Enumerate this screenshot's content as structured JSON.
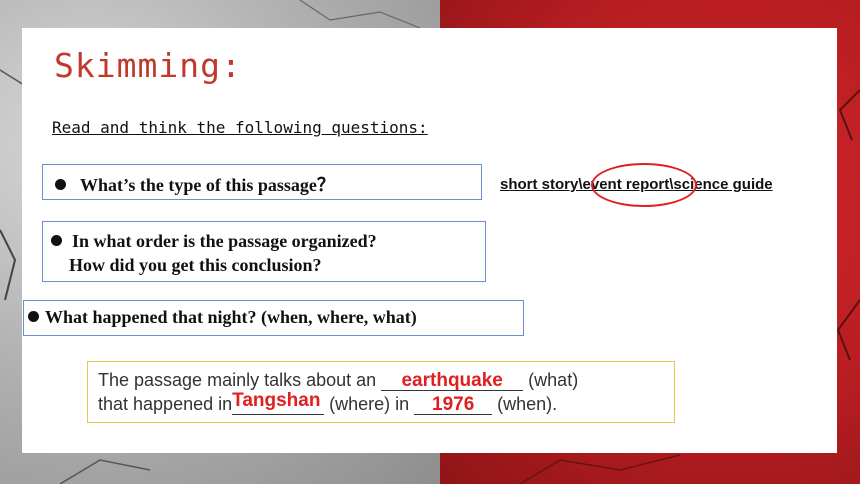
{
  "slide": {
    "title": "Skimming:",
    "instruction": "Read and think the following questions:",
    "questions": [
      {
        "text": "What’s the type of this passage？"
      },
      {
        "line1": "In what order is the passage organized?",
        "line2": "How did you get this conclusion?"
      },
      {
        "text": "What happened that night? (when, where, what)"
      }
    ],
    "choices": {
      "opt1": "short story",
      "sep1": "\\",
      "opt2": "event report",
      "sep2": "\\",
      "opt3": "science guide",
      "circled": "event report"
    },
    "summary": {
      "part1": "The passage mainly talks about an ",
      "answer_what": "earthquake",
      "part2": "  (what)",
      "part3": "that happened in",
      "answer_where": "Tangshan",
      "part4": " (where)  in ",
      "answer_when": "1976",
      "part5": "  (when)."
    }
  },
  "colors": {
    "title": "#c0392b",
    "answer": "#e02020",
    "question_border": "#6a8fd4",
    "summary_border": "#f0c34a",
    "background_red": "#c0392b"
  }
}
